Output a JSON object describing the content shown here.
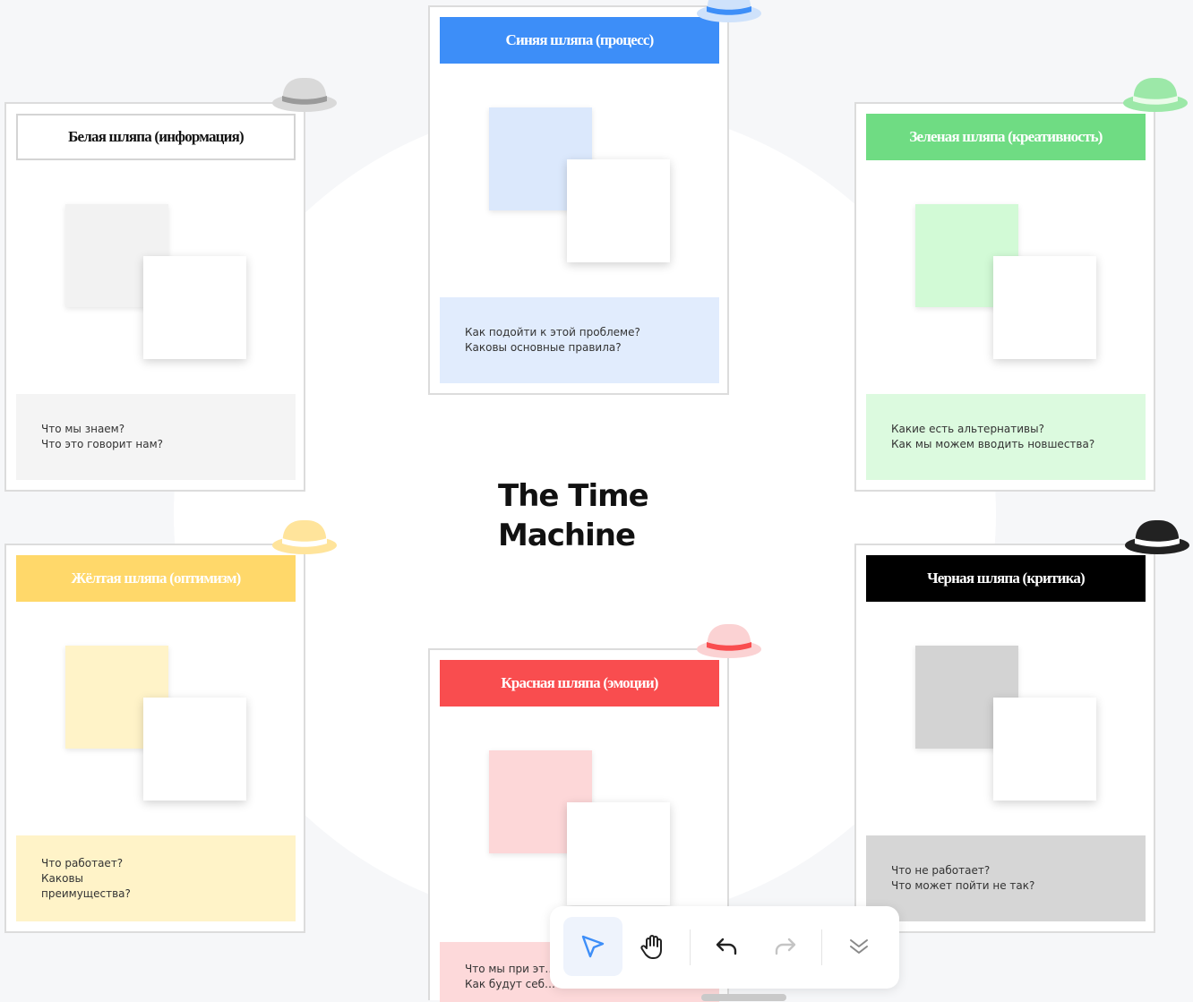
{
  "board": {
    "title_line1": "The Time",
    "title_line2": "Machine"
  },
  "cards": {
    "white": {
      "title": "Белая шляпа (информация)",
      "note": "Что мы знаем?\nЧто это говорит нам?",
      "header_bg": "#ffffff",
      "header_text": "#111111",
      "note_bg": "#f4f4f4",
      "square_color": "#f2f2f2",
      "hat_color": "#d9d9d9",
      "hat_band": "#9a9a9a"
    },
    "blue": {
      "title": "Синяя шляпа (процесс)",
      "note": "Как подойти к этой проблеме?\nКаковы основные правила?",
      "header_bg": "#3d8ef8",
      "header_text": "#ffffff",
      "note_bg": "#e1ecfd",
      "square_color": "#dbe8fc",
      "hat_color": "#cfe2fb",
      "hat_band": "#3d8ef8"
    },
    "green": {
      "title": "Зеленая шляпа (креативность)",
      "note": "Какие есть альтернативы?\nКак мы можем вводить новшества?",
      "header_bg": "#6fdc83",
      "header_text": "#ffffff",
      "note_bg": "#dcfadf",
      "square_color": "#d2fad6",
      "hat_color": "#9ce8a8",
      "hat_band": "#eafbe9"
    },
    "yellow": {
      "title": "Жёлтая шляпа (оптимизм)",
      "note": "Что работает?\nКаковы\nпреимущества?",
      "header_bg": "#ffd86a",
      "header_text": "#ffffff",
      "note_bg": "#fff3c8",
      "square_color": "#fff3c8",
      "hat_color": "#ffe49b",
      "hat_band": "#ffffff"
    },
    "red": {
      "title": "Красная шляпа (эмоции)",
      "note": "Что мы при эт…\nКак будут себ…",
      "header_bg": "#f94d4f",
      "header_text": "#ffffff",
      "note_bg": "#fdd9da",
      "square_color": "#fdd7d8",
      "hat_color": "#fbd2d3",
      "hat_band": "#f94d4f"
    },
    "black": {
      "title": "Черная шляпа (критика)",
      "note": "Что не работает?\nЧто может пойти не так?",
      "header_bg": "#000000",
      "header_text": "#ffffff",
      "note_bg": "#d6d6d6",
      "square_color": "#d3d3d3",
      "hat_color": "#222222",
      "hat_band": "#ffffff"
    }
  },
  "toolbar": {
    "tools": [
      {
        "name": "select",
        "icon": "cursor-arrow-icon",
        "active": true
      },
      {
        "name": "pan",
        "icon": "hand-icon",
        "active": false
      },
      {
        "name": "undo",
        "icon": "undo-icon",
        "active": false
      },
      {
        "name": "redo",
        "icon": "redo-icon",
        "active": false
      },
      {
        "name": "more",
        "icon": "double-chevron-down-icon",
        "active": false
      }
    ],
    "accent": "#3d8ef8"
  }
}
